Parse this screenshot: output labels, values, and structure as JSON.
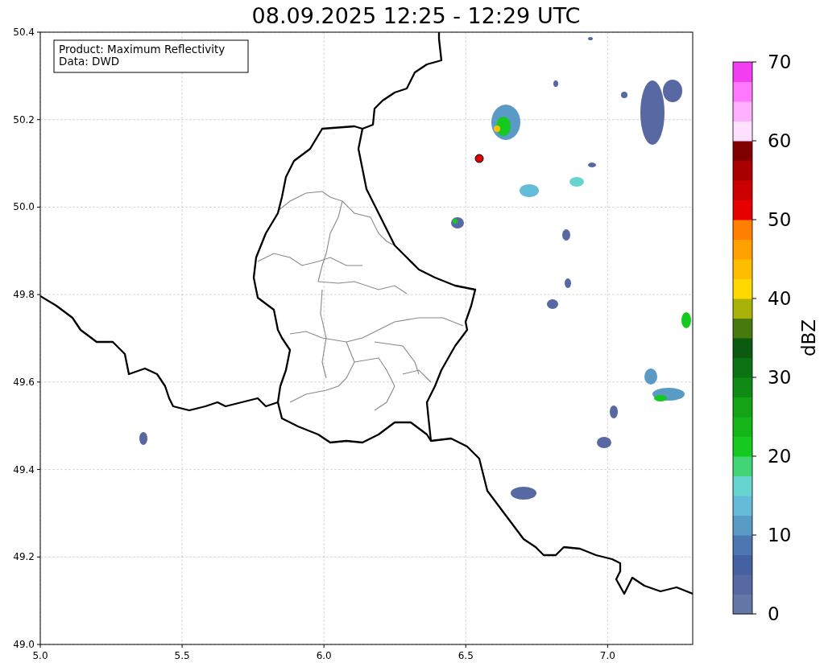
{
  "title": "08.09.2025 12:25 - 12:29 UTC",
  "annotation": [
    "Product: Maximum Reflectivity",
    "Data: DWD"
  ],
  "x_ticks": [
    "5.0",
    "5.5",
    "6.0",
    "6.5",
    "7.0"
  ],
  "y_ticks": [
    "50.4",
    "50.2",
    "50.0",
    "49.8",
    "49.6",
    "49.4",
    "49.2",
    "49.0"
  ],
  "colorbar": {
    "label": "dBZ",
    "ticks": [
      "70",
      "60",
      "50",
      "40",
      "30",
      "20",
      "10",
      "0"
    ],
    "segments": [
      {
        "color": "#6577a7"
      },
      {
        "color": "#5768a3"
      },
      {
        "color": "#4661a1"
      },
      {
        "color": "#4c77b0"
      },
      {
        "color": "#5a9bc6"
      },
      {
        "color": "#64bcd8"
      },
      {
        "color": "#66d4cf"
      },
      {
        "color": "#41d576"
      },
      {
        "color": "#15c91e"
      },
      {
        "color": "#14b518"
      },
      {
        "color": "#13a416"
      },
      {
        "color": "#0f8a14"
      },
      {
        "color": "#0c7312"
      },
      {
        "color": "#0b5a10"
      },
      {
        "color": "#467a0c"
      },
      {
        "color": "#a8b208"
      },
      {
        "color": "#ffd800"
      },
      {
        "color": "#ffbd00"
      },
      {
        "color": "#ffa000"
      },
      {
        "color": "#ff7f00"
      },
      {
        "color": "#e60000"
      },
      {
        "color": "#cc0000"
      },
      {
        "color": "#a80000"
      },
      {
        "color": "#800000"
      },
      {
        "color": "#ffe0ff"
      },
      {
        "color": "#ffb0ff"
      },
      {
        "color": "#ff78ff"
      },
      {
        "color": "#f03ef0"
      }
    ]
  }
}
